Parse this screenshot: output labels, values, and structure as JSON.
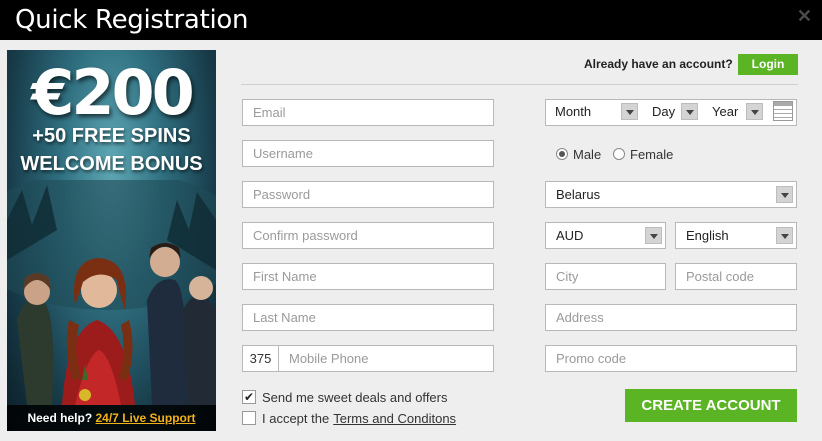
{
  "header": {
    "title": "Quick Registration",
    "close_icon": "close-icon"
  },
  "banner": {
    "amount": "€200",
    "spins": "+50 FREE SPINS",
    "bonus": "WELCOME BONUS",
    "help_prefix": "Need help?",
    "help_link": "24/7 Live Support"
  },
  "account": {
    "already_text": "Already have an account?",
    "login_label": "Login"
  },
  "fields": {
    "email": "Email",
    "username": "Username",
    "password": "Password",
    "confirm_password": "Confirm password",
    "first_name": "First Name",
    "last_name": "Last Name",
    "phone_code": "375",
    "mobile_phone": "Mobile Phone",
    "city": "City",
    "postal_code": "Postal code",
    "address": "Address",
    "promo_code": "Promo code"
  },
  "birth": {
    "month": "Month",
    "day": "Day",
    "year": "Year",
    "calendar_icon": "calendar-icon"
  },
  "gender": {
    "male": "Male",
    "female": "Female",
    "selected": "male"
  },
  "selects": {
    "country": "Belarus",
    "currency": "AUD",
    "language": "English"
  },
  "checks": {
    "deals_label": "Send me sweet deals and offers",
    "deals_checked": true,
    "terms_prefix": "I accept the",
    "terms_link": "Terms and Conditons",
    "terms_checked": false
  },
  "create_label": "CREATE ACCOUNT",
  "colors": {
    "accent_green": "#5ab424",
    "header_bg": "#000000",
    "help_link": "#f3b21b"
  }
}
